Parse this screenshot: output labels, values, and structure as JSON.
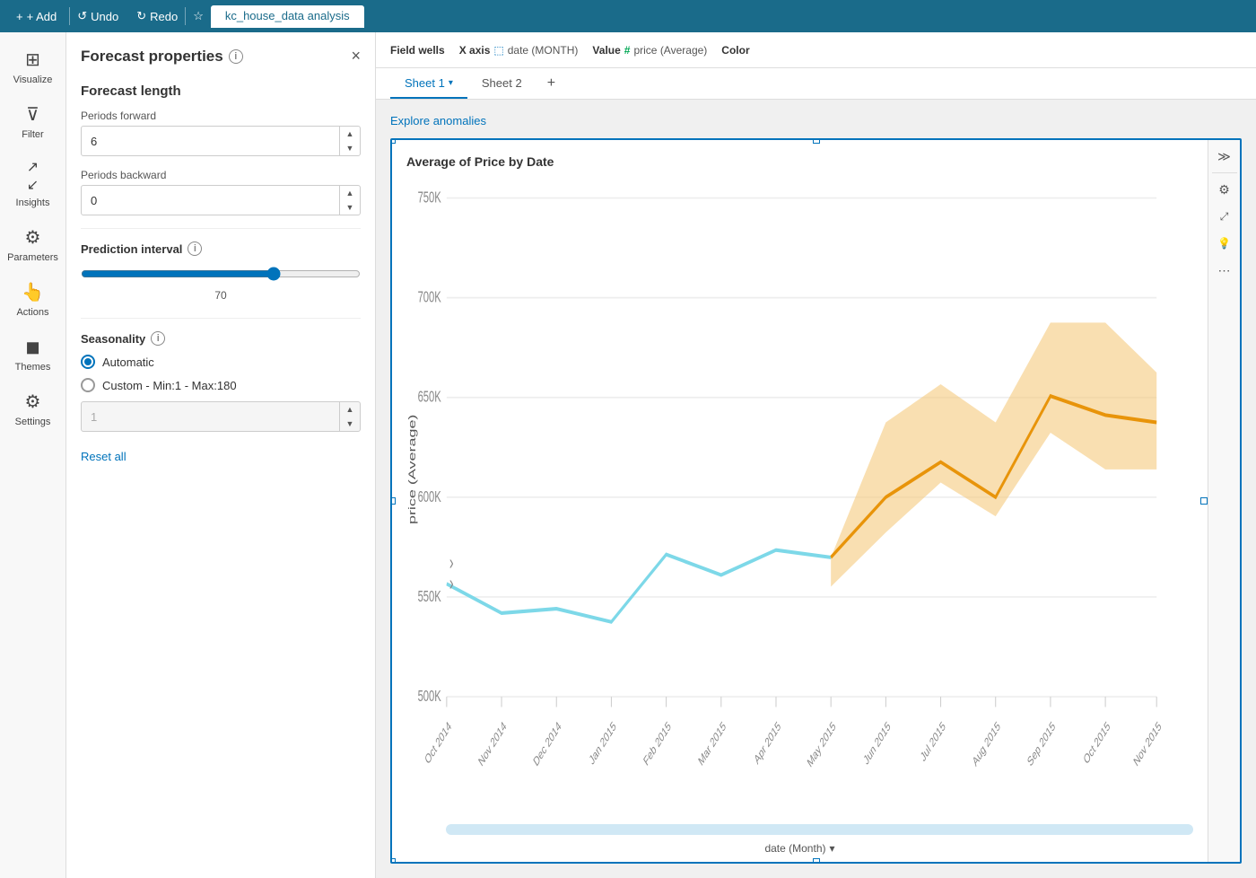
{
  "topbar": {
    "add_label": "+ Add",
    "undo_label": "Undo",
    "redo_label": "Redo",
    "tab_title": "kc_house_data analysis"
  },
  "nav": {
    "items": [
      {
        "id": "visualize",
        "label": "Visualize",
        "icon": "▦"
      },
      {
        "id": "filter",
        "label": "Filter",
        "icon": "⛉"
      },
      {
        "id": "insights",
        "label": "Insights",
        "icon": "↗"
      },
      {
        "id": "parameters",
        "label": "Parameters",
        "icon": "⚙"
      },
      {
        "id": "actions",
        "label": "Actions",
        "icon": "☞"
      },
      {
        "id": "themes",
        "label": "Themes",
        "icon": "◼"
      },
      {
        "id": "settings",
        "label": "Settings",
        "icon": "⚙"
      }
    ]
  },
  "forecast_panel": {
    "title": "Forecast properties",
    "info_icon": "i",
    "close_icon": "×",
    "forecast_length_title": "Forecast length",
    "periods_forward_label": "Periods forward",
    "periods_forward_value": "6",
    "periods_backward_label": "Periods backward",
    "periods_backward_value": "0",
    "prediction_interval_label": "Prediction interval",
    "prediction_interval_value": 70,
    "prediction_interval_display": "70",
    "seasonality_label": "Seasonality",
    "auto_label": "Automatic",
    "custom_label": "Custom - Min:1 - Max:180",
    "custom_value": "1",
    "reset_label": "Reset all"
  },
  "field_wells": {
    "label": "Field wells",
    "x_axis_label": "X axis",
    "x_axis_icon": "☷",
    "x_axis_field": "date (MONTH)",
    "value_label": "Value",
    "value_icon": "#",
    "value_field": "price (Average)",
    "color_label": "Color"
  },
  "sheets": {
    "sheet1_label": "Sheet 1",
    "sheet2_label": "Sheet 2",
    "add_icon": "+"
  },
  "chart": {
    "title": "Average of Price by Date",
    "explore_anomalies": "Explore anomalies",
    "y_axis_label": "price (Average)",
    "x_axis_label": "date (Month)",
    "y_ticks": [
      "750K",
      "700K",
      "650K",
      "600K",
      "550K",
      "500K"
    ],
    "x_ticks": [
      "Oct 2014",
      "Nov 2014",
      "Dec 2014",
      "Jan 2015",
      "Feb 2015",
      "Mar 2015",
      "Apr 2015",
      "May 2015",
      "Jun 2015",
      "Jul 2015",
      "Aug 2015",
      "Sep 2015",
      "Oct 2015",
      "Nov 2015"
    ],
    "toolbar": {
      "chevron_icon": "≫",
      "gear_icon": "⚙",
      "expand_icon": "⤢",
      "lightbulb_icon": "💡",
      "more_icon": "⋯"
    }
  }
}
